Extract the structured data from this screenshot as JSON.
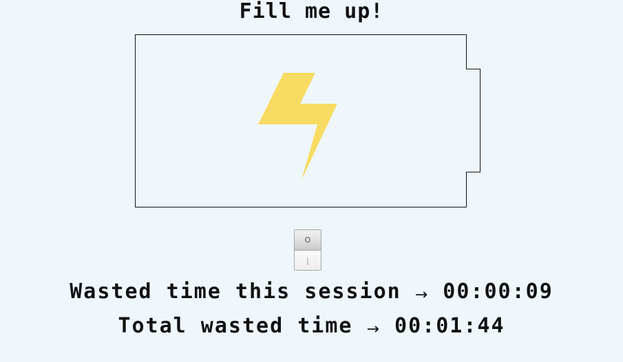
{
  "title": "Fill me up!",
  "battery": {
    "fill_level": 0,
    "bolt_color": "#f8db63",
    "outline_color": "#111111",
    "icon": "lightning-bolt-icon"
  },
  "toggle": {
    "off_symbol": "O",
    "on_symbol": "|",
    "state": "off"
  },
  "stats": {
    "session_label": "Wasted time this session",
    "session_arrow": "→",
    "session_value": "00:00:09",
    "total_label": "Total wasted time",
    "total_arrow": "→",
    "total_value": "00:01:44"
  },
  "colors": {
    "background": "#eff7fd",
    "text": "#111111"
  }
}
